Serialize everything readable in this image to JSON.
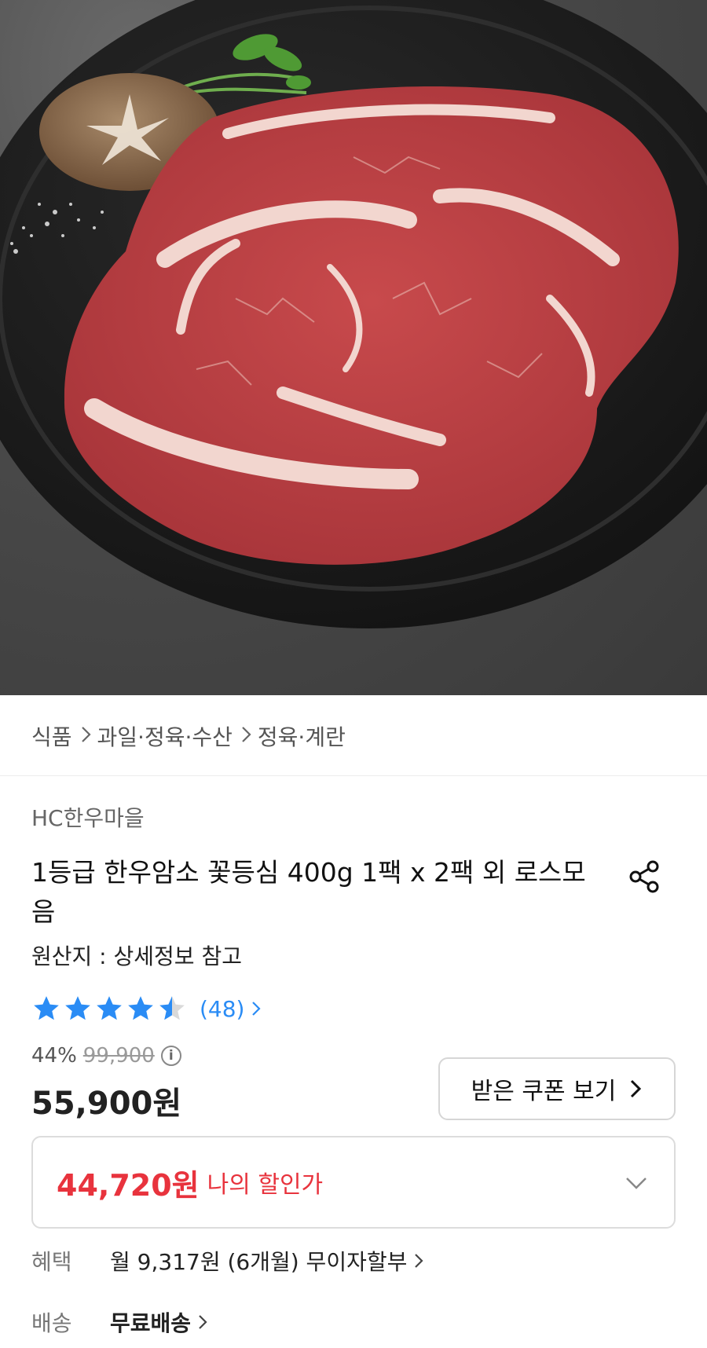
{
  "hero": {
    "image_alt": "hanwoo steak on a black plate",
    "colors": {
      "background": "#4a4a4a",
      "plate": "#1c1c1c",
      "meat": "#b73a3e",
      "fat": "#f1d3cc"
    }
  },
  "breadcrumb": {
    "items": [
      "식품",
      "과일·정육·수산",
      "정육·계란"
    ],
    "separator_icon": "chevron-right-icon"
  },
  "product": {
    "brand": "HC한우마을",
    "title": "1등급 한우암소 꽃등심 400g 1팩 x 2팩 외 로스모음",
    "origin": "원산지 : 상세정보 참고",
    "share_icon": "share-icon"
  },
  "rating": {
    "value": 4.5,
    "max": 5,
    "count_text": "(48)",
    "color": "#2a8cf5"
  },
  "price": {
    "discount_rate": "44%",
    "original": "99,900",
    "sale": "55,900원",
    "info_icon": "info-icon"
  },
  "coupon": {
    "label": "받은 쿠폰 보기",
    "icon": "chevron-right-icon"
  },
  "my_deal": {
    "amount": "44,720원",
    "label": "나의 할인가",
    "accent": "#e8333d",
    "icon": "chevron-down-icon"
  },
  "benefit": {
    "key": "혜택",
    "value": "월 9,317원 (6개월) 무이자할부"
  },
  "shipping": {
    "key": "배송",
    "value": "무료배송"
  }
}
